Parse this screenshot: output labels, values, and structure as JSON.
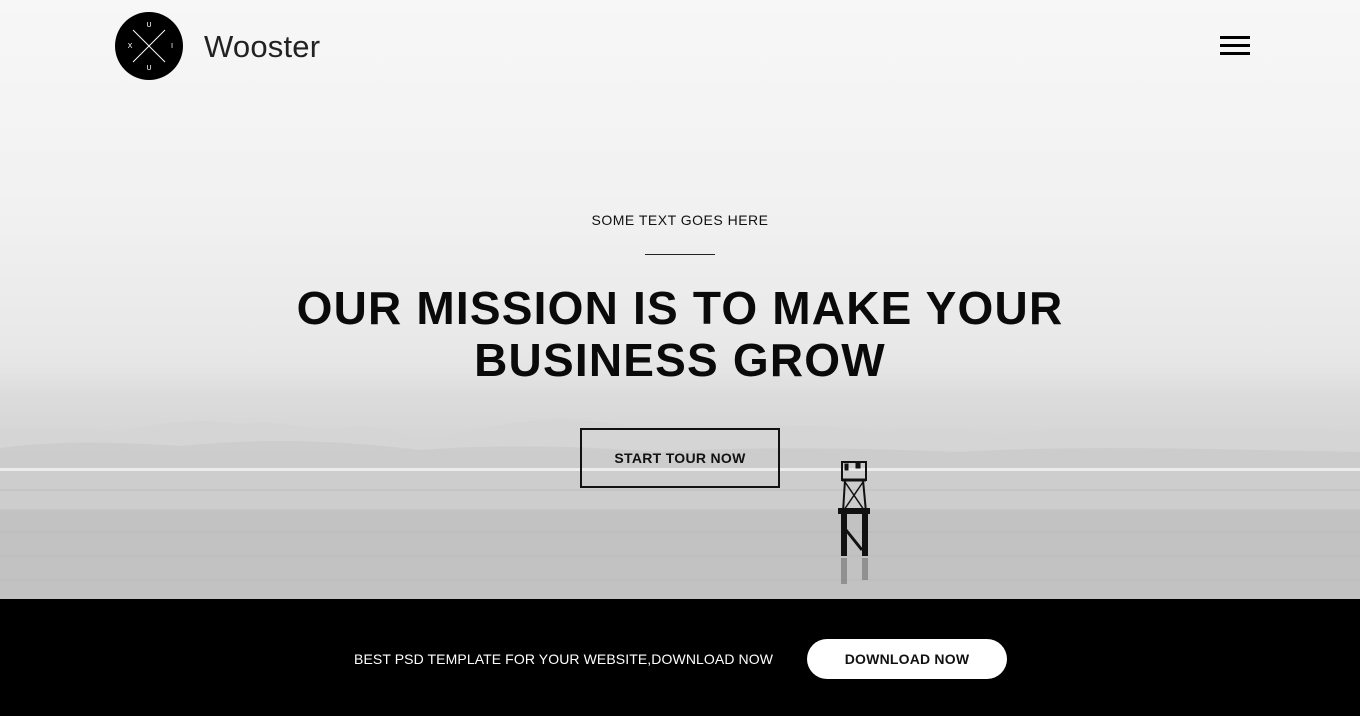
{
  "header": {
    "logo_letters": [
      "U",
      "I",
      "U",
      "X"
    ],
    "brand": "Wooster",
    "menu_icon": "hamburger-menu-icon"
  },
  "hero": {
    "eyebrow": "SOME TEXT GOES HERE",
    "headline": "OUR MISSION IS TO MAKE YOUR BUSINESS GROW",
    "cta_label": "START TOUR NOW"
  },
  "promo": {
    "text": "BEST PSD TEMPLATE FOR YOUR WEBSITE,DOWNLOAD NOW",
    "button_label": "DOWNLOAD NOW"
  },
  "colors": {
    "text": "#000000",
    "bar_background": "#000000",
    "bar_text": "#ffffff",
    "button_background": "#ffffff"
  }
}
